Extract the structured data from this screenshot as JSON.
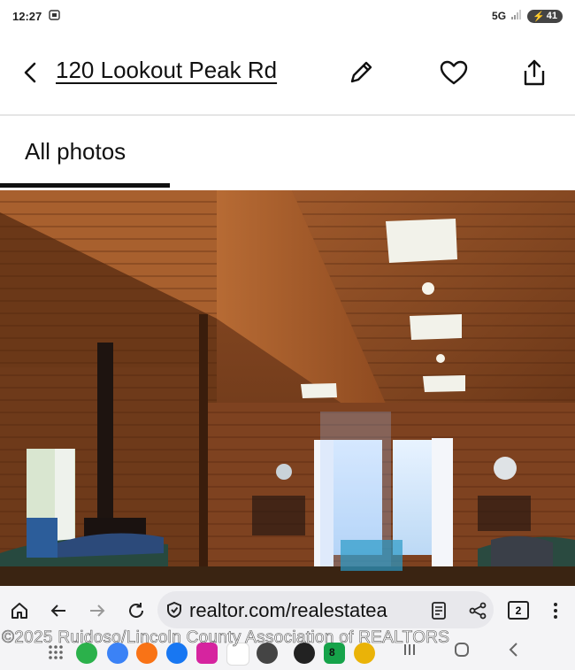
{
  "status_bar": {
    "time": "12:27",
    "network": "5G",
    "battery": "41"
  },
  "header": {
    "title": "120 Lookout Peak Rd"
  },
  "tabs": [
    {
      "label": "All photos",
      "active": true
    }
  ],
  "browser": {
    "url": "realtor.com/realestatea",
    "tab_count": "2"
  },
  "dock": {
    "badge": "8"
  },
  "photo": {
    "watermark": "©2025 Ruidoso/Lincoln County Association of REALTORS"
  },
  "colors": {
    "accent": "#111111",
    "wood": "#8a4a22"
  }
}
